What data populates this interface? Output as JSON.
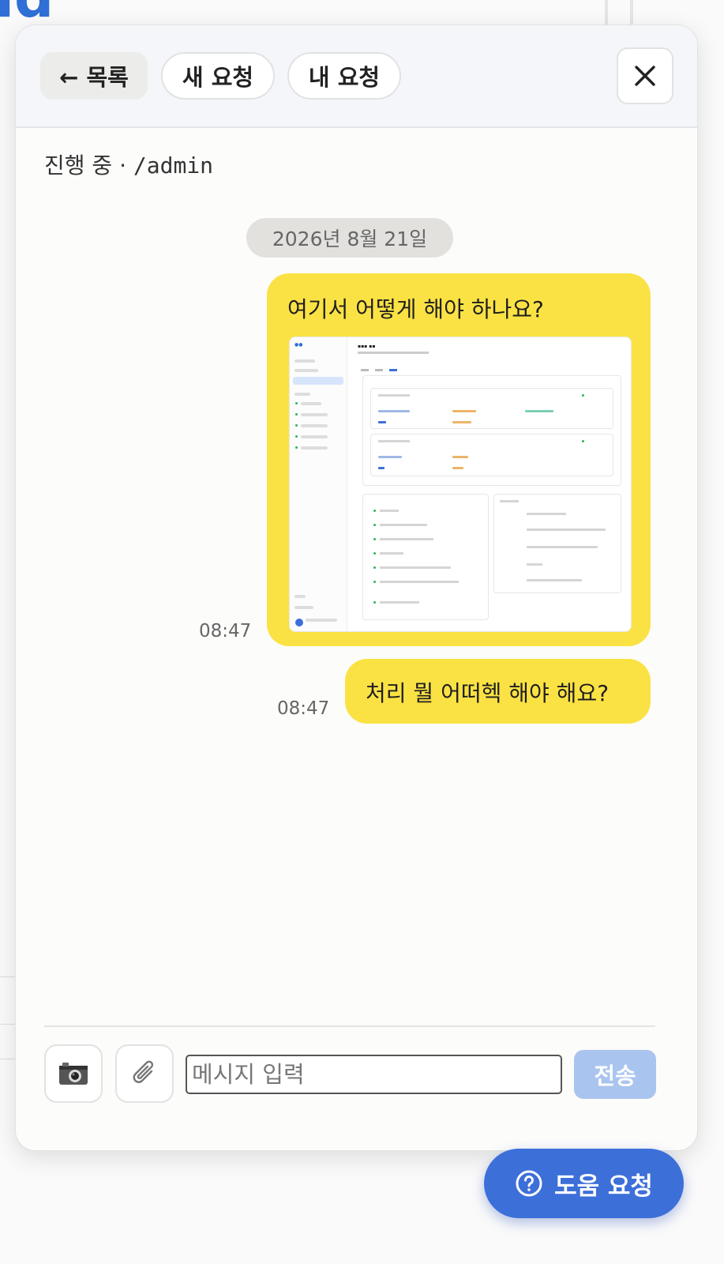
{
  "header": {
    "back_label": "← 목록",
    "new_request_label": "새 요청",
    "my_requests_label": "내 요청",
    "close_icon": "close-icon"
  },
  "status": {
    "state": "진행 중",
    "separator": " · ",
    "path": "/admin"
  },
  "chat": {
    "date": "2026년 8월 21일",
    "messages": [
      {
        "text": "여기서 어떻게 해야 하나요?",
        "time": "08:47",
        "attachment": "screenshot"
      },
      {
        "text": "처리 뭘 어떠헥 해야 해요?",
        "time": "08:47"
      }
    ]
  },
  "composer": {
    "camera_icon": "camera-icon",
    "attach_icon": "paperclip-icon",
    "placeholder": "메시지 입력",
    "send_label": "전송"
  },
  "help_button": {
    "label": "도움 요청",
    "icon": "question-circle-icon"
  },
  "colors": {
    "bubble": "#fbe244",
    "accent": "#3d6fd9",
    "send_disabled": "#a9c4ee"
  }
}
